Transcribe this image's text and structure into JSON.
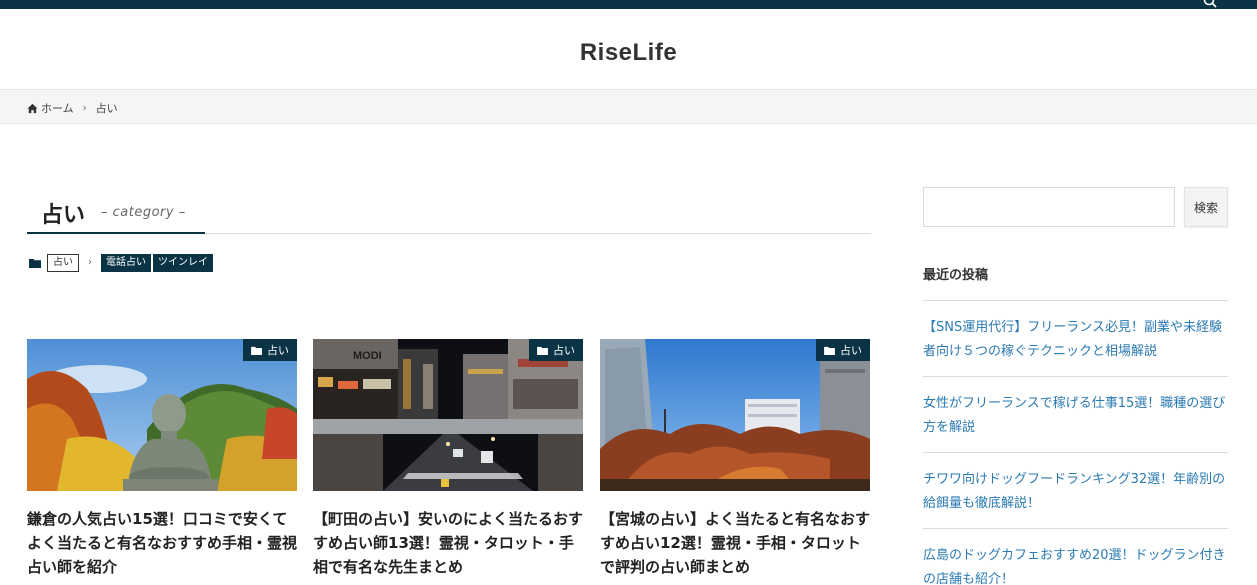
{
  "site": {
    "title": "RiseLife"
  },
  "topbar": {
    "search_icon": "search-icon"
  },
  "breadcrumb": {
    "home_label": "ホーム",
    "current_label": "占い"
  },
  "category": {
    "title": "占い",
    "subtitle": "– category –"
  },
  "tags": {
    "current": "占い",
    "children": [
      "電話占い",
      "ツインレイ"
    ]
  },
  "cards": [
    {
      "badge": "占い",
      "title": "鎌倉の人気占い15選！口コミで安くてよく当たると有名なおすすめ手相・霊視占い師を紹介",
      "image": "kamakura-buddha-photo"
    },
    {
      "badge": "占い",
      "title": "【町田の占い】安いのによく当たるおすすめ占い師13選！霊視・タロット・手相で有名な先生まとめ",
      "image": "machida-street-night-photo",
      "sign": "MODI"
    },
    {
      "badge": "占い",
      "title": "【宮城の占い】よく当たると有名なおすすめ占い12選！霊視・手相・タロットで評判の占い師まとめ",
      "image": "miyagi-city-autumn-photo"
    }
  ],
  "sidebar": {
    "search_placeholder": "",
    "search_button": "検索",
    "recent_title": "最近の投稿",
    "recent_posts": [
      "【SNS運用代行】フリーランス必見！副業や未経験者向け５つの稼ぐテクニックと相場解説",
      "女性がフリーランスで稼げる仕事15選！職種の選び方を解説",
      "チワワ向けドッグフードランキング32選！年齢別の給餌量も徹底解説！",
      "広島のドッグカフェおすすめ20選！ドッグラン付きの店舗も紹介！"
    ]
  },
  "colors": {
    "accent": "#0b3346",
    "link": "#2a7ab3",
    "crumb_bg": "#f5f5f5"
  }
}
